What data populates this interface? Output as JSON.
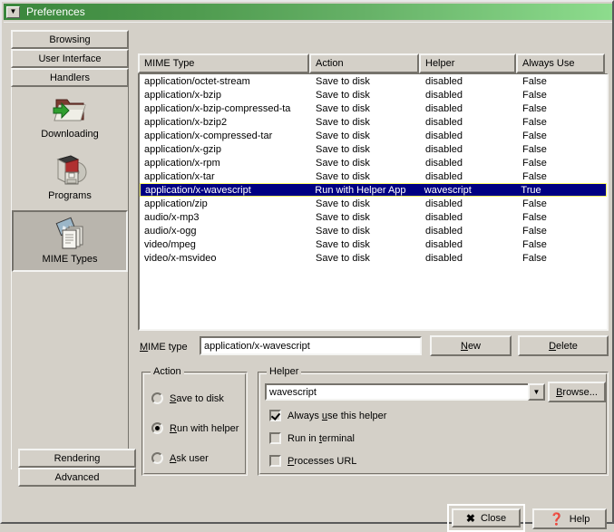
{
  "window": {
    "title": "Preferences",
    "menu_icon": "window-menu-icon",
    "title_color": "#3a863c"
  },
  "sidebar": {
    "tabs": [
      {
        "label": "Browsing"
      },
      {
        "label": "User Interface"
      },
      {
        "label": "Handlers"
      }
    ],
    "categories": [
      {
        "label": "Downloading",
        "icon": "folder-download-icon",
        "selected": false
      },
      {
        "label": "Programs",
        "icon": "software-box-icon",
        "selected": false
      },
      {
        "label": "MIME Types",
        "icon": "documents-stack-icon",
        "selected": true
      }
    ],
    "bottom_buttons": [
      {
        "label": "Rendering"
      },
      {
        "label": "Advanced"
      }
    ]
  },
  "list": {
    "columns": [
      {
        "label": "MIME Type"
      },
      {
        "label": "Action"
      },
      {
        "label": "Helper"
      },
      {
        "label": "Always Use"
      }
    ],
    "selected_color": "#000082",
    "focus_color": "#ffff64",
    "rows": [
      {
        "mime": "application/octet-stream",
        "action": "Save to disk",
        "helper": "disabled",
        "always": "False",
        "selected": false
      },
      {
        "mime": "application/x-bzip",
        "action": "Save to disk",
        "helper": "disabled",
        "always": "False",
        "selected": false
      },
      {
        "mime": "application/x-bzip-compressed-ta",
        "action": "Save to disk",
        "helper": "disabled",
        "always": "False",
        "selected": false
      },
      {
        "mime": "application/x-bzip2",
        "action": "Save to disk",
        "helper": "disabled",
        "always": "False",
        "selected": false
      },
      {
        "mime": "application/x-compressed-tar",
        "action": "Save to disk",
        "helper": "disabled",
        "always": "False",
        "selected": false
      },
      {
        "mime": "application/x-gzip",
        "action": "Save to disk",
        "helper": "disabled",
        "always": "False",
        "selected": false
      },
      {
        "mime": "application/x-rpm",
        "action": "Save to disk",
        "helper": "disabled",
        "always": "False",
        "selected": false
      },
      {
        "mime": "application/x-tar",
        "action": "Save to disk",
        "helper": "disabled",
        "always": "False",
        "selected": false
      },
      {
        "mime": "application/x-wavescript",
        "action": "Run with Helper App",
        "helper": "wavescript",
        "always": "True",
        "selected": true
      },
      {
        "mime": "application/zip",
        "action": "Save to disk",
        "helper": "disabled",
        "always": "False",
        "selected": false
      },
      {
        "mime": "audio/x-mp3",
        "action": "Save to disk",
        "helper": "disabled",
        "always": "False",
        "selected": false
      },
      {
        "mime": "audio/x-ogg",
        "action": "Save to disk",
        "helper": "disabled",
        "always": "False",
        "selected": false
      },
      {
        "mime": "video/mpeg",
        "action": "Save to disk",
        "helper": "disabled",
        "always": "False",
        "selected": false
      },
      {
        "mime": "video/x-msvideo",
        "action": "Save to disk",
        "helper": "disabled",
        "always": "False",
        "selected": false
      }
    ]
  },
  "mime_row": {
    "label_accel": "M",
    "label_rest": "IME type",
    "value": "application/x-wavescript",
    "new_accel": "N",
    "new_rest": "ew",
    "delete_accel": "D",
    "delete_rest": "elete"
  },
  "action_group": {
    "title": "Action",
    "options": [
      {
        "accel": "S",
        "rest": "ave to disk",
        "checked": false
      },
      {
        "accel": "R",
        "rest": "un with helper",
        "checked": true
      },
      {
        "accel": "A",
        "rest": "sk user",
        "checked": false
      }
    ]
  },
  "helper_group": {
    "title": "Helper",
    "combo_value": "wavescript",
    "combo_arrow_icon": "chevron-down-icon",
    "browse_accel": "B",
    "browse_rest": "rowse...",
    "checkboxes": [
      {
        "pre": "Always ",
        "accel": "u",
        "rest": "se this helper",
        "checked": true
      },
      {
        "pre": "Run in ",
        "accel": "t",
        "rest": "erminal",
        "checked": false
      },
      {
        "pre": "",
        "accel": "P",
        "rest": "rocesses URL",
        "checked": false
      }
    ]
  },
  "footer": {
    "close_label": "Close",
    "close_icon": "x-icon",
    "help_label": "Help",
    "help_icon": "question-mark-icon"
  }
}
